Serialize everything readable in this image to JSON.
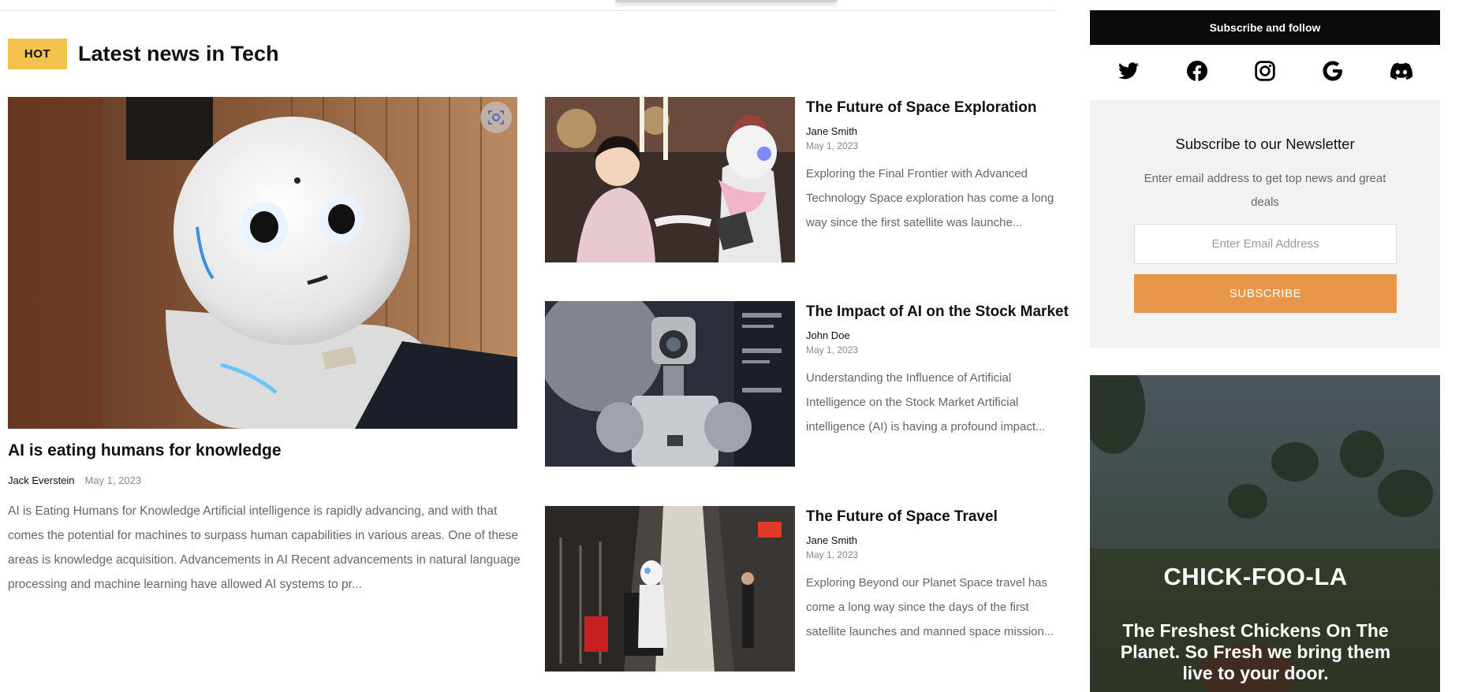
{
  "section": {
    "badge": "HOT",
    "title": "Latest news in Tech"
  },
  "featured": {
    "title": "AI is eating humans for knowledge",
    "author": "Jack Everstein",
    "date": "May 1, 2023",
    "excerpt": "AI is Eating Humans for Knowledge Artificial intelligence is rapidly advancing, and with that comes the potential for machines to surpass human capabilities in various areas. One of these areas is knowledge acquisition. Advancements in AI Recent advancements in natural language processing and machine learning have allowed AI systems to pr..."
  },
  "articles": [
    {
      "title": "The Future of Space Exploration",
      "author": "Jane Smith",
      "date": "May 1, 2023",
      "excerpt": "Exploring the Final Frontier with Advanced Technology Space exploration has come a long way since the first satellite was launche..."
    },
    {
      "title": "The Impact of AI on the Stock Market",
      "author": "John Doe",
      "date": "May 1, 2023",
      "excerpt": "Understanding the Influence of Artificial Intelligence on the Stock Market Artificial intelligence (AI) is having a profound impact..."
    },
    {
      "title": "The Future of Space Travel",
      "author": "Jane Smith",
      "date": "May 1, 2023",
      "excerpt": "Exploring Beyond our Planet Space travel has come a long way since the days of the first satellite launches and manned space mission..."
    }
  ],
  "sidebar": {
    "follow_label": "Subscribe and follow",
    "social": [
      "twitter-icon",
      "facebook-icon",
      "instagram-icon",
      "google-icon",
      "discord-icon"
    ],
    "newsletter": {
      "title": "Subscribe to our Newsletter",
      "description": "Enter email address to get top news and great deals",
      "placeholder": "Enter Email Address",
      "button": "SUBSCRIBE"
    },
    "ad": {
      "brand": "CHICK-FOO-LA",
      "tagline": "The Freshest Chickens On The Planet. So Fresh we bring them live to your door."
    }
  },
  "colors": {
    "badge": "#f2c14e",
    "subscribe_button": "#e8964a",
    "follow_bar": "#0b0b0b"
  }
}
